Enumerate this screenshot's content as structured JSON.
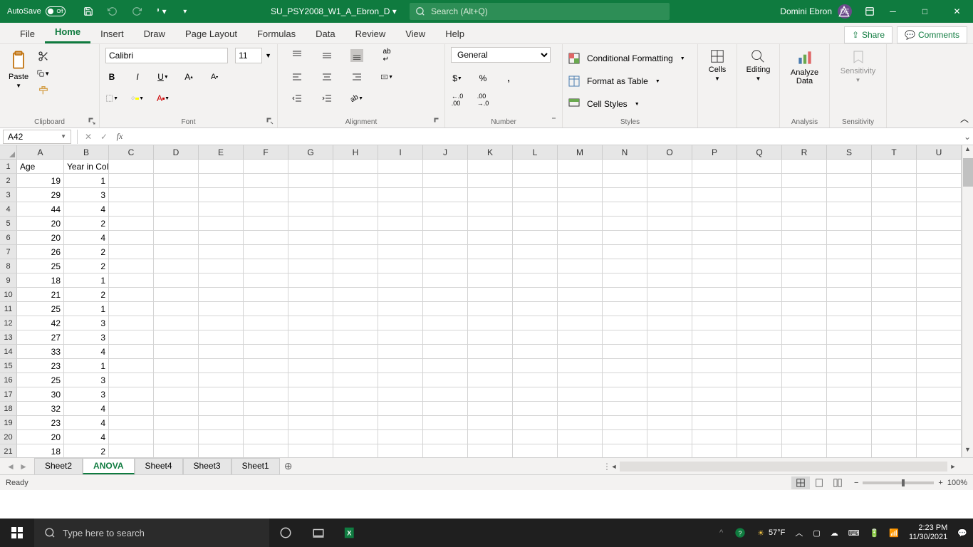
{
  "titlebar": {
    "autosave_label": "AutoSave",
    "autosave_state": "Off",
    "doc_name": "SU_PSY2008_W1_A_Ebron_D",
    "search_placeholder": "Search (Alt+Q)",
    "user_name": "Domini Ebron",
    "user_initials": "DE"
  },
  "tabs": {
    "items": [
      "File",
      "Home",
      "Insert",
      "Draw",
      "Page Layout",
      "Formulas",
      "Data",
      "Review",
      "View",
      "Help"
    ],
    "active": "Home",
    "share": "Share",
    "comments": "Comments"
  },
  "ribbon": {
    "clipboard": {
      "paste": "Paste",
      "label": "Clipboard"
    },
    "font": {
      "name": "Calibri",
      "size": "11",
      "label": "Font"
    },
    "alignment": {
      "label": "Alignment"
    },
    "number": {
      "format": "General",
      "label": "Number"
    },
    "styles": {
      "cf": "Conditional Formatting",
      "fat": "Format as Table",
      "cs": "Cell Styles",
      "label": "Styles"
    },
    "cells": {
      "label": "Cells"
    },
    "editing": {
      "label": "Editing"
    },
    "analysis": {
      "analyze": "Analyze Data",
      "label": "Analysis"
    },
    "sensitivity": {
      "btn": "Sensitivity",
      "label": "Sensitivity"
    }
  },
  "formula_bar": {
    "name_box": "A42",
    "formula": ""
  },
  "columns": [
    "A",
    "B",
    "C",
    "D",
    "E",
    "F",
    "G",
    "H",
    "I",
    "J",
    "K",
    "L",
    "M",
    "N",
    "O",
    "P",
    "Q",
    "R",
    "S",
    "T",
    "U"
  ],
  "row_numbers": [
    1,
    2,
    3,
    4,
    5,
    6,
    7,
    8,
    9,
    10,
    11,
    12,
    13,
    14,
    15,
    16,
    17,
    18,
    19,
    20,
    21
  ],
  "grid": {
    "headers": [
      "Age",
      "Year in College"
    ],
    "rows": [
      [
        19,
        1
      ],
      [
        29,
        3
      ],
      [
        44,
        4
      ],
      [
        20,
        2
      ],
      [
        20,
        4
      ],
      [
        26,
        2
      ],
      [
        25,
        2
      ],
      [
        18,
        1
      ],
      [
        21,
        2
      ],
      [
        25,
        1
      ],
      [
        42,
        3
      ],
      [
        27,
        3
      ],
      [
        33,
        4
      ],
      [
        23,
        1
      ],
      [
        25,
        3
      ],
      [
        30,
        3
      ],
      [
        32,
        4
      ],
      [
        23,
        4
      ],
      [
        20,
        4
      ],
      [
        18,
        2
      ]
    ]
  },
  "sheets": {
    "tabs": [
      "Sheet2",
      "ANOVA",
      "Sheet4",
      "Sheet3",
      "Sheet1"
    ],
    "active": "ANOVA"
  },
  "status": {
    "ready": "Ready",
    "zoom": "100%"
  },
  "taskbar": {
    "search_placeholder": "Type here to search",
    "weather": "57°F",
    "time": "2:23 PM",
    "date": "11/30/2021"
  }
}
